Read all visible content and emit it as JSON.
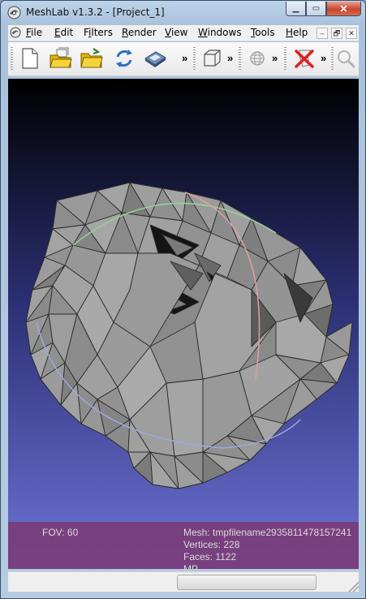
{
  "window": {
    "title": "MeshLab v1.3.2 - [Project_1]"
  },
  "caption_buttons": {
    "minimize": "▁",
    "maximize": "▭",
    "close": "✕"
  },
  "menu": {
    "items": [
      {
        "label": "File",
        "accel": "F"
      },
      {
        "label": "Edit",
        "accel": "E"
      },
      {
        "label": "Filters",
        "accel": "i"
      },
      {
        "label": "Render",
        "accel": "R"
      },
      {
        "label": "View",
        "accel": "V"
      },
      {
        "label": "Windows",
        "accel": "W"
      },
      {
        "label": "Tools",
        "accel": "T"
      },
      {
        "label": "Help",
        "accel": "H"
      }
    ],
    "mdi_buttons": [
      "–",
      "🗗",
      "✕"
    ]
  },
  "toolbar": {
    "buttons": [
      {
        "icon": "new-file-icon"
      },
      {
        "icon": "open-project-icon"
      },
      {
        "icon": "open-mesh-icon"
      },
      {
        "icon": "reload-icon"
      },
      {
        "icon": "save-icon"
      },
      {
        "icon": "bounding-box-icon"
      },
      {
        "icon": "globe-icon"
      },
      {
        "icon": "delete-current-icon"
      },
      {
        "icon": "zoom-icon"
      }
    ],
    "extension": "»"
  },
  "viewport": {
    "background_top": "#000000",
    "background_bottom": "#6d73d6"
  },
  "info": {
    "fov": "FOV: 60",
    "mesh": "Mesh: tmpfilename2935811478157241",
    "vertices": "Vertices: 228",
    "faces": "Faces: 1122",
    "mode": "MP"
  }
}
